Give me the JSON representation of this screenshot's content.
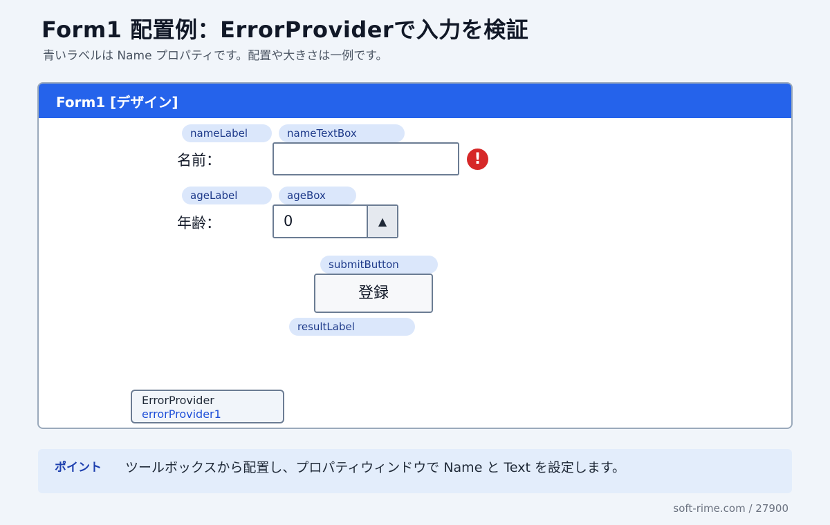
{
  "header": {
    "title": "Form1 配置例：ErrorProviderで入力を検証",
    "subtitle": "青いラベルは Name プロパティです。配置や大きさは一例です。"
  },
  "window": {
    "title": "Form1 [デザイン]"
  },
  "form": {
    "name_tag": "nameLabel",
    "name_label": "名前：",
    "name_textbox_tag": "nameTextBox",
    "name_textbox_value": "",
    "error_icon_glyph": "!",
    "age_tag": "ageLabel",
    "age_label": "年齢：",
    "age_box_tag": "ageBox",
    "age_value": "0",
    "age_up_glyph": "▲",
    "submit_tag": "submitButton",
    "submit_label": "登録",
    "result_tag": "resultLabel"
  },
  "component_tray": {
    "type": "ErrorProvider",
    "name": "errorProvider1"
  },
  "note": {
    "label": "ポイント",
    "text": "ツールボックスから配置し、プロパティウィンドウで Name と Text を設定します。"
  },
  "footer": {
    "text": "soft-rime.com / 27900"
  },
  "colors": {
    "accent": "#2563eb",
    "tag_bg": "#dbe7fb",
    "error": "#d62828"
  },
  "icons": {
    "error": "error-icon",
    "spin_up": "triangle-up-icon"
  }
}
